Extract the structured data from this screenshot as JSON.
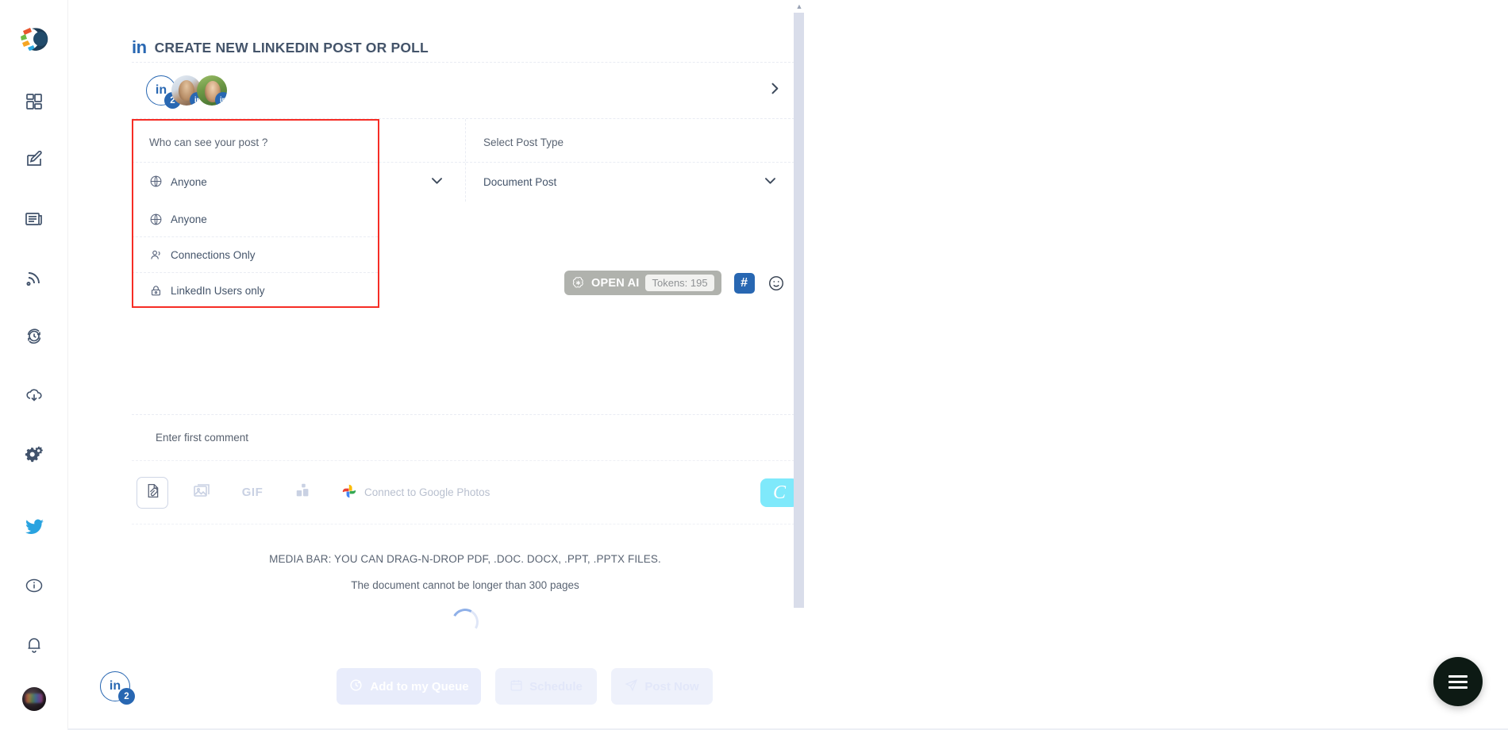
{
  "app": {
    "logo_name": "app-logo"
  },
  "sidebar": {
    "items": [
      {
        "name": "dashboard",
        "label": "Dashboard",
        "icon": "grid-icon"
      },
      {
        "name": "compose",
        "label": "Compose",
        "icon": "pencil-square-icon"
      },
      {
        "name": "content",
        "label": "Content",
        "icon": "newspaper-icon"
      },
      {
        "name": "feeds",
        "label": "Feeds",
        "icon": "rss-icon"
      },
      {
        "name": "history",
        "label": "History",
        "icon": "clock-refresh-icon"
      },
      {
        "name": "downloads",
        "label": "Downloads",
        "icon": "cloud-download-icon"
      },
      {
        "name": "settings",
        "label": "Settings",
        "icon": "gears-icon"
      }
    ],
    "bottom_items": [
      {
        "name": "twitter",
        "label": "Twitter",
        "icon": "twitter-bird-icon"
      },
      {
        "name": "info",
        "label": "Info",
        "icon": "info-circle-icon"
      },
      {
        "name": "notifications",
        "label": "Notifications",
        "icon": "bell-icon"
      },
      {
        "name": "profile",
        "label": "Profile",
        "icon": "user-avatar"
      }
    ]
  },
  "header": {
    "network_mark": "in",
    "title": "CREATE NEW LINKEDIN POST OR POLL"
  },
  "accounts": {
    "primary_mark": "in",
    "primary_count": "2",
    "badge_mark": "in",
    "next_icon": "chevron-right-icon"
  },
  "visibility": {
    "label": "Who can see your post ?",
    "selected": "Anyone",
    "selected_icon": "globe-icon",
    "chevron": "chevron-down-icon",
    "options": [
      {
        "label": "Anyone",
        "icon": "globe-icon"
      },
      {
        "label": "Connections Only",
        "icon": "people-icon"
      },
      {
        "label": "LinkedIn Users only",
        "icon": "lock-icon"
      }
    ],
    "highlight_color": "#f62d25"
  },
  "post_type": {
    "label": "Select Post Type",
    "selected": "Document Post",
    "chevron": "chevron-down-icon"
  },
  "ai_bar": {
    "brand": "OPEN AI",
    "brand_icon": "openai-logo-icon",
    "tokens": "Tokens: 195",
    "hashtag_label": "#",
    "emoji_icon": "smiley-icon"
  },
  "comment": {
    "placeholder": "Enter first comment"
  },
  "media_toolbar": {
    "buttons": [
      {
        "name": "attach-document-button",
        "icon": "document-attachment-icon",
        "label": ""
      },
      {
        "name": "add-image-button",
        "icon": "image-icon",
        "label": ""
      },
      {
        "name": "add-gif-button",
        "icon": "gif-icon",
        "label": "GIF"
      },
      {
        "name": "add-poll-button",
        "icon": "poll-chart-icon",
        "label": ""
      }
    ],
    "google_photos": "Connect to Google Photos",
    "google_photos_icon": "google-photos-icon",
    "brand_button_label": "C"
  },
  "dropzone": {
    "line1": "MEDIA BAR: YOU CAN DRAG-N-DROP PDF, .DOC. DOCX, .PPT, .PPTX FILES.",
    "line2": "The document cannot be longer than 300 pages",
    "loading_icon": "spinner-icon"
  },
  "bottom_bar": {
    "account_mark": "in",
    "account_count": "2",
    "actions": [
      {
        "name": "add-to-queue-button",
        "label": "Add to my Queue",
        "icon": "queue-refresh-icon"
      },
      {
        "name": "schedule-button",
        "label": "Schedule",
        "icon": "calendar-icon"
      },
      {
        "name": "post-now-button",
        "label": "Post Now",
        "icon": "send-icon"
      }
    ]
  },
  "fab": {
    "icon": "hamburger-menu-icon",
    "color": "#0d1a14"
  },
  "scrollbar": {
    "up_arrow": "▲"
  }
}
